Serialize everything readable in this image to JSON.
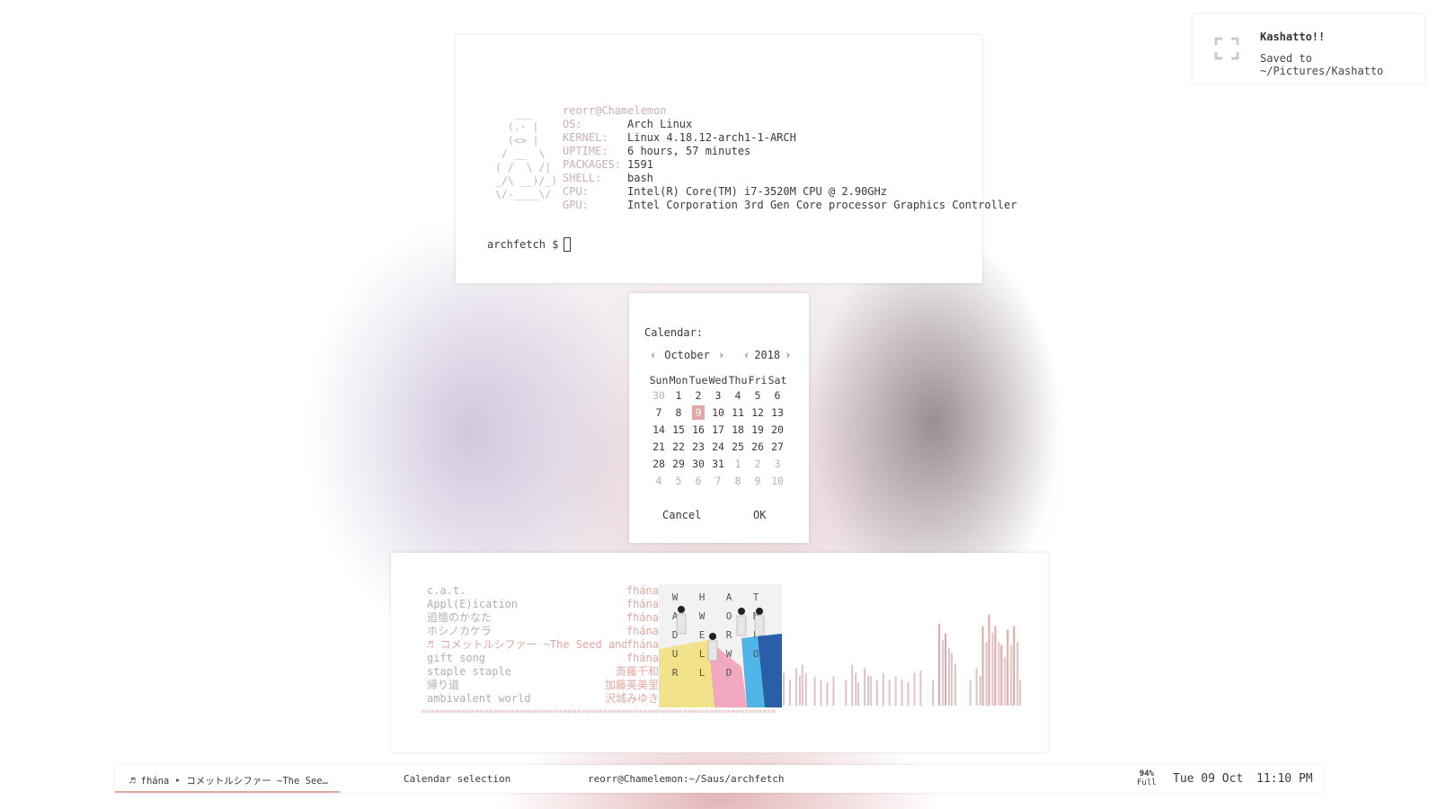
{
  "terminal": {
    "ascii_art": "   ___\n  (.· |\n  (<> |\n / __  \\\n( /  \\ /|\n_/\\ __)/_)\n\\/-____\\/",
    "userhost": "reorr@Chamelemon",
    "info": [
      {
        "key": "OS:",
        "value": "Arch Linux"
      },
      {
        "key": "KERNEL:",
        "value": "Linux 4.18.12-arch1-1-ARCH"
      },
      {
        "key": "UPTIME:",
        "value": "6 hours, 57 minutes"
      },
      {
        "key": "PACKAGES:",
        "value": "1591"
      },
      {
        "key": "SHELL:",
        "value": "bash"
      },
      {
        "key": "CPU:",
        "value": "Intel(R) Core(TM) i7-3520M CPU @ 2.90GHz"
      },
      {
        "key": "GPU:",
        "value": "Intel Corporation 3rd Gen Core processor Graphics Controller"
      }
    ],
    "prompt": "archfetch $"
  },
  "notification": {
    "title": "Kashatto!!",
    "body": "Saved to ~/Pictures/Kashatto",
    "icon": "screenshot-corners-icon"
  },
  "calendar": {
    "title": "Calendar:",
    "month": "October",
    "year": "2018",
    "weekdays": [
      "Sun",
      "Mon",
      "Tue",
      "Wed",
      "Thu",
      "Fri",
      "Sat"
    ],
    "weeks": [
      [
        "30",
        "1",
        "2",
        "3",
        "4",
        "5",
        "6"
      ],
      [
        "7",
        "8",
        "9",
        "10",
        "11",
        "12",
        "13"
      ],
      [
        "14",
        "15",
        "16",
        "17",
        "18",
        "19",
        "20"
      ],
      [
        "21",
        "22",
        "23",
        "24",
        "25",
        "26",
        "27"
      ],
      [
        "28",
        "29",
        "30",
        "31",
        "1",
        "2",
        "3"
      ],
      [
        "4",
        "5",
        "6",
        "7",
        "8",
        "9",
        "10"
      ]
    ],
    "muted": [
      [
        0,
        0
      ],
      [
        4,
        4
      ],
      [
        4,
        5
      ],
      [
        4,
        6
      ],
      [
        5,
        0
      ],
      [
        5,
        1
      ],
      [
        5,
        2
      ],
      [
        5,
        3
      ],
      [
        5,
        4
      ],
      [
        5,
        5
      ],
      [
        5,
        6
      ]
    ],
    "selected": [
      1,
      2
    ],
    "cancel_label": "Cancel",
    "ok_label": "OK"
  },
  "player": {
    "tracks": [
      {
        "title": "c.a.t.",
        "artist": "fhána"
      },
      {
        "title": "Appl(E)ication",
        "artist": "fhána"
      },
      {
        "title": "追憶のかなた",
        "artist": "fhána"
      },
      {
        "title": "ホシノカケラ",
        "artist": "fhána"
      },
      {
        "title": "♬ コメットルシファー ~The Seed and",
        "artist": "fhána",
        "now_playing": true
      },
      {
        "title": "gift song",
        "artist": "fhána"
      },
      {
        "title": "staple staple",
        "artist": "斎藤千和"
      },
      {
        "title": "帰り道",
        "artist": "加藤英美里"
      },
      {
        "title": "ambivalent world",
        "artist": "沢城みゆき"
      }
    ],
    "progress_text": "»»»»»»»»»»»»»»»»»»»»»»»»»»»»»»»»»»»»»»»»»»»»»»»»»»»»»»»»»»»»»»»»»»»»»»»»»»»»»»»»",
    "cover_letters": [
      "W",
      "H",
      "A",
      "T",
      "A",
      "W",
      "O",
      "N",
      "D",
      "E",
      "R",
      "F",
      "U",
      "L",
      "W",
      "O",
      "R",
      "L",
      "D"
    ],
    "visualizer_levels": [
      0.28,
      0.22,
      0.32,
      0.35,
      0.0,
      0.25,
      0.22,
      0.2,
      0.25,
      0.0,
      0.22,
      0.35,
      0.2,
      0.32,
      0.25,
      0.22,
      0.28,
      0.22,
      0.25,
      0.22,
      0.2,
      0.28,
      0.3,
      0.0,
      0.22,
      0.7,
      0.62,
      0.45,
      0.0,
      0.0,
      0.22,
      0.32,
      0.68,
      0.78,
      0.68,
      0.52,
      0.65,
      0.68,
      0.22
    ],
    "accent_color": "#e3a7a3",
    "muted_color": "#b5aeb0"
  },
  "statusbar": {
    "music": "♬ fhána ‣ コメットルシファー ~The See…",
    "window_title": "Calendar selection",
    "terminal_title": "reorr@Chamelemon:~/Saus/archfetch",
    "battery_percent": "94%",
    "battery_status": "Full",
    "date": "Tue 09 Oct",
    "time": "11:10 PM"
  }
}
